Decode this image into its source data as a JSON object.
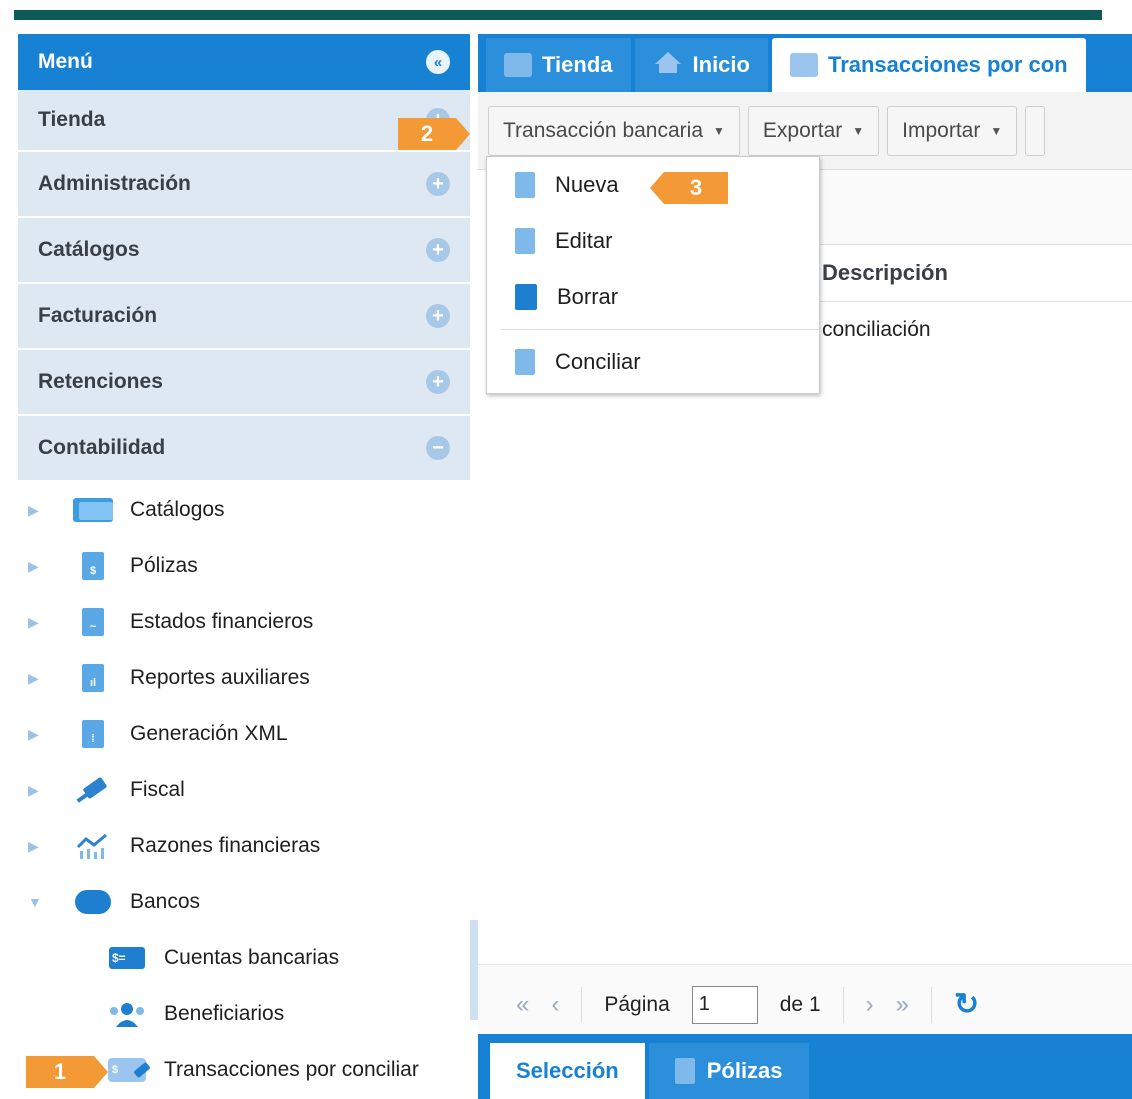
{
  "sidebar": {
    "title": "Menú",
    "sections": [
      {
        "label": "Tienda",
        "state": "plus"
      },
      {
        "label": "Administración",
        "state": "plus"
      },
      {
        "label": "Catálogos",
        "state": "plus"
      },
      {
        "label": "Facturación",
        "state": "plus"
      },
      {
        "label": "Retenciones",
        "state": "plus"
      },
      {
        "label": "Contabilidad",
        "state": "minus"
      }
    ],
    "tree": [
      {
        "label": "Catálogos",
        "icon": "folder-icon"
      },
      {
        "label": "Pólizas",
        "icon": "policy-doc-icon"
      },
      {
        "label": "Estados financieros",
        "icon": "financial-doc-icon"
      },
      {
        "label": "Reportes auxiliares",
        "icon": "report-icon"
      },
      {
        "label": "Generación XML",
        "icon": "xml-doc-icon"
      },
      {
        "label": "Fiscal",
        "icon": "gavel-icon"
      },
      {
        "label": "Razones financieras",
        "icon": "chart-icon"
      },
      {
        "label": "Bancos",
        "icon": "piggy-bank-icon"
      }
    ],
    "bank_children": [
      {
        "label": "Cuentas bancarias",
        "icon": "money-icon"
      },
      {
        "label": "Beneficiarios",
        "icon": "people-icon"
      },
      {
        "label": "Transacciones por conciliar",
        "icon": "transaction-icon"
      }
    ]
  },
  "tabs": [
    {
      "label": "Tienda"
    },
    {
      "label": "Inicio"
    },
    {
      "label": "Transacciones por con"
    }
  ],
  "toolbar": {
    "bank_transaction": "Transacción bancaria",
    "export": "Exportar",
    "import": "Importar"
  },
  "dropdown": {
    "items": [
      "Nueva",
      "Editar",
      "Borrar",
      "Conciliar"
    ]
  },
  "grid": {
    "header": "Descripción",
    "rows": [
      "conciliación"
    ]
  },
  "pager": {
    "page_label": "Página",
    "page_value": "1",
    "of_label": "de 1"
  },
  "bottom_tabs": [
    "Selección",
    "Pólizas"
  ],
  "badges": [
    "1",
    "2",
    "3"
  ],
  "colors": {
    "accent": "#1782d3",
    "badge": "#f39a36",
    "header_line": "#0f5a57"
  }
}
